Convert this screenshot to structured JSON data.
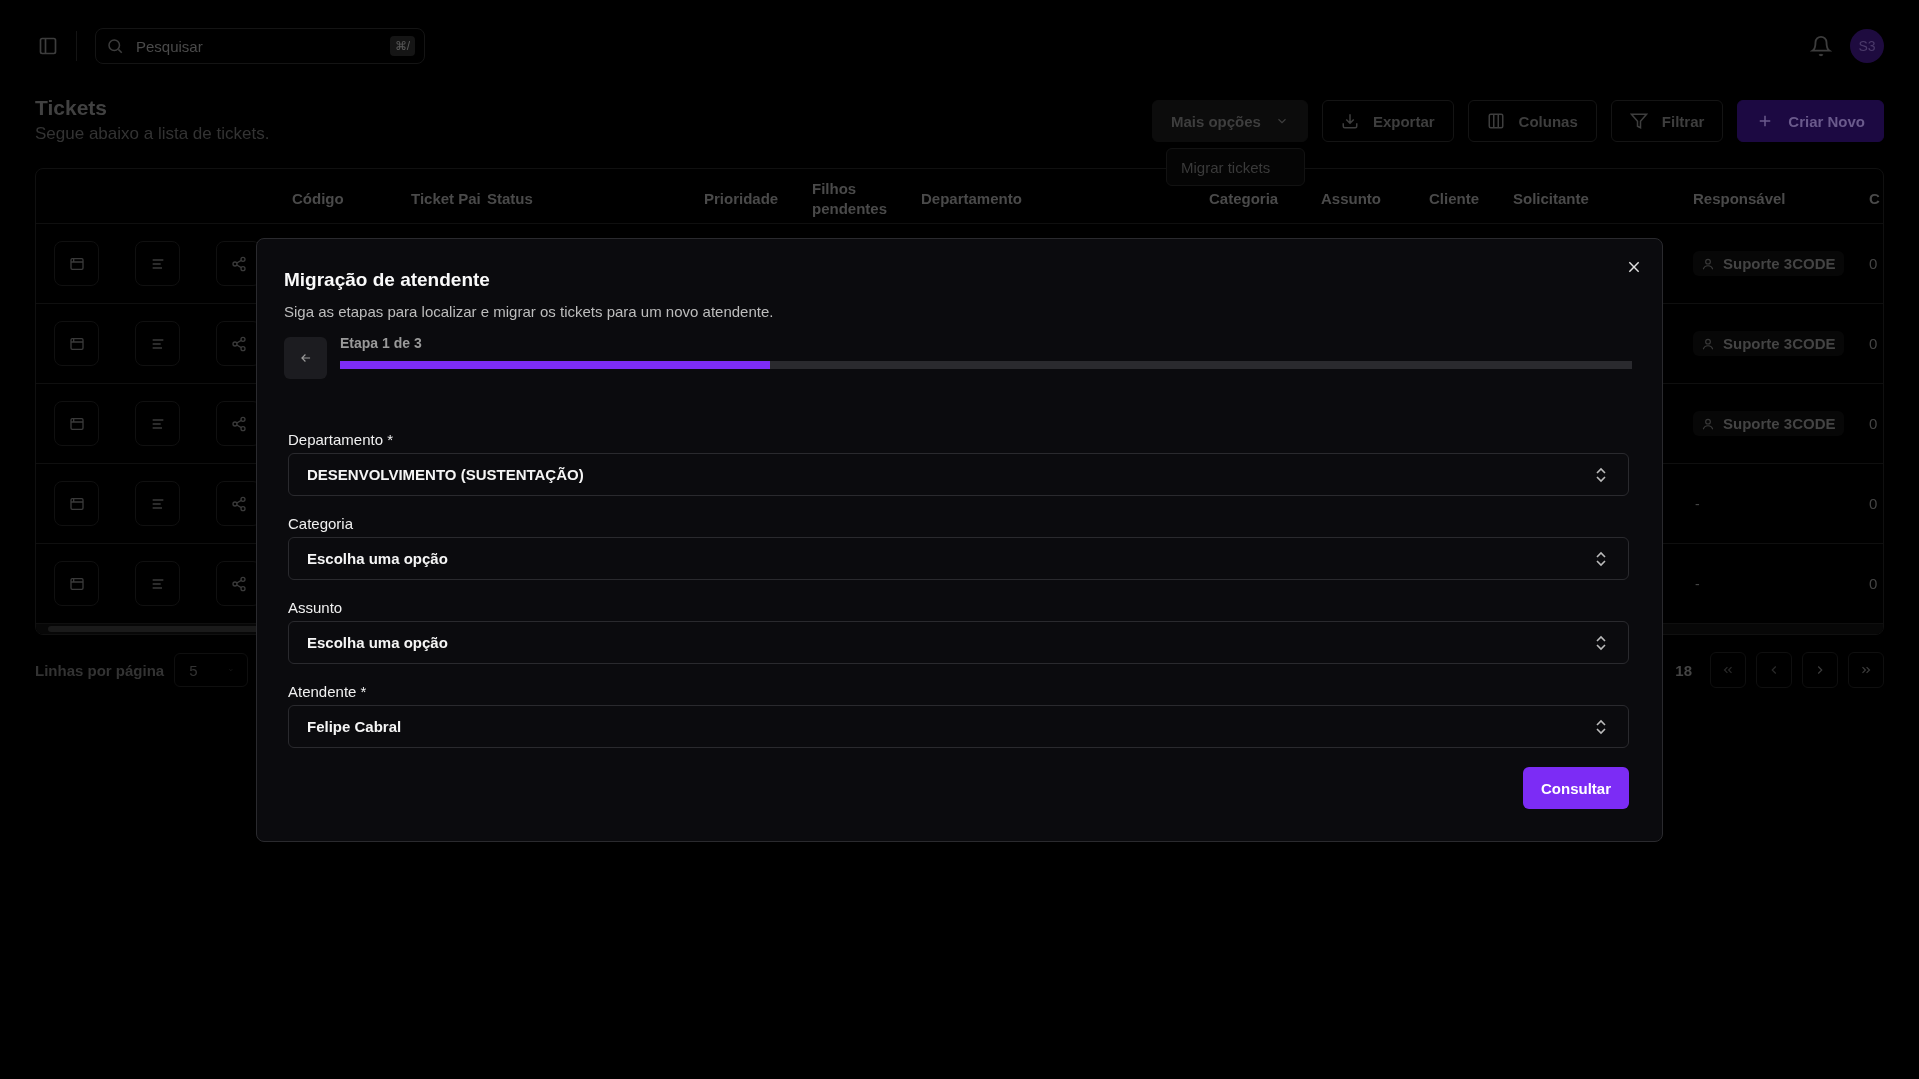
{
  "topbar": {
    "search": {
      "placeholder": "Pesquisar",
      "shortcut": "⌘/"
    },
    "avatar": "S3"
  },
  "page": {
    "title": "Tickets",
    "subtitle": "Segue abaixo a lista de tickets."
  },
  "actions": [
    {
      "label": "Mais opções",
      "kind": "dropdown"
    },
    {
      "label": "Exportar",
      "kind": "export"
    },
    {
      "label": "Colunas",
      "kind": "columns"
    },
    {
      "label": "Filtrar",
      "kind": "filter"
    },
    {
      "label": "Criar Novo",
      "kind": "create"
    }
  ],
  "menu": {
    "items": [
      "Migrar tickets"
    ]
  },
  "table": {
    "columns": [
      "Código",
      "Ticket Pai",
      "Status",
      "Prioridade",
      "Filhos pendentes",
      "Departamento",
      "Categoria",
      "Assunto",
      "Cliente",
      "Solicitante",
      "Responsável",
      "C"
    ],
    "rows": [
      {
        "responsavel": {
          "kind": "user",
          "text": "Suporte 3CODE"
        },
        "column_13": "0"
      },
      {
        "responsavel": {
          "kind": "user",
          "text": "Suporte 3CODE"
        },
        "column_13": "0"
      },
      {
        "responsavel": {
          "kind": "user",
          "text": "Suporte 3CODE"
        },
        "column_13": "0"
      },
      {
        "responsavel": {
          "kind": "empty",
          "text": "-"
        },
        "column_13": "0"
      },
      {
        "responsavel": {
          "kind": "empty",
          "text": "-"
        },
        "column_13": "0"
      }
    ]
  },
  "pagination": {
    "rows_per_page_label": "Linhas por página",
    "rows_per_page": "5",
    "page_info": "18"
  },
  "modal": {
    "title": "Migração de atendente",
    "description": "Siga as etapas para localizar e migrar os tickets para um novo atendente.",
    "step_label": "Etapa 1 de 3",
    "level": 0.333,
    "fields": [
      {
        "label": "Departamento *",
        "value": "DESENVOLVIMENTO (SUSTENTAÇÃO)"
      },
      {
        "label": "Categoria",
        "placeholder": "Escolha uma opção"
      },
      {
        "label": "Assunto",
        "placeholder": "Escolha uma opção"
      },
      {
        "label": "Atendente *",
        "value": "Felipe Cabral"
      }
    ],
    "submit": "Consultar"
  }
}
